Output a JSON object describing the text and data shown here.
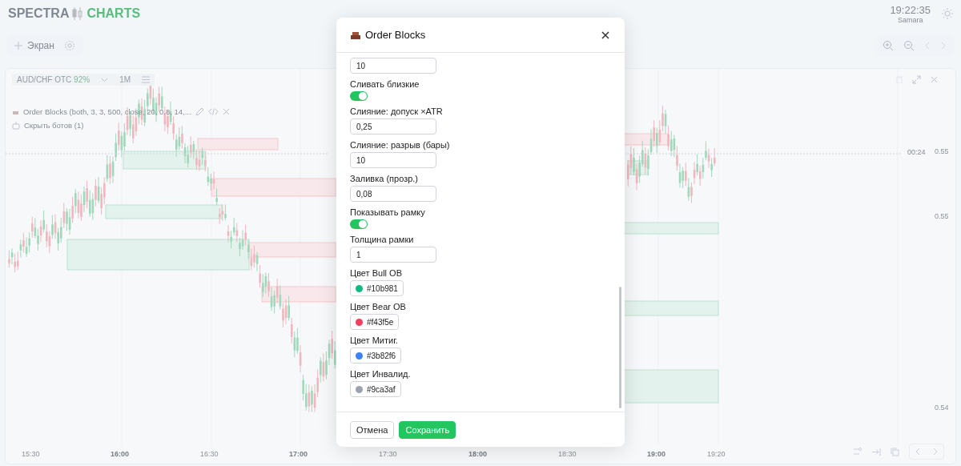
{
  "header": {
    "brand": [
      "SPECTRA",
      "CHARTS"
    ],
    "clock": "19:22:35",
    "city": "Samara"
  },
  "toolbar": {
    "screen_button": "Экран"
  },
  "chart_panel": {
    "symbol": "AUD/CHF OTC",
    "payout": "92%",
    "timeframe": "1M",
    "indicator_legend": "Order Blocks (both, 3, 3, 500, close, 20, 0.8, 14,...",
    "hide_bots": "Скрыть ботов (1)",
    "countdown": "00:24",
    "price_labels": [
      "0.55",
      "0.55",
      "0.54"
    ],
    "time_labels": [
      {
        "label": "15:30",
        "bold": false
      },
      {
        "label": "16:00",
        "bold": true
      },
      {
        "label": "16:30",
        "bold": false
      },
      {
        "label": "17:00",
        "bold": true
      },
      {
        "label": "17:30",
        "bold": false
      },
      {
        "label": "18:00",
        "bold": true
      },
      {
        "label": "18:30",
        "bold": false
      },
      {
        "label": "19:00",
        "bold": true
      },
      {
        "label": "19:20",
        "bold": false
      }
    ]
  },
  "dialog": {
    "title": "Order Blocks",
    "fields": [
      {
        "kind": "number",
        "value": "10"
      },
      {
        "kind": "toggle",
        "label": "Сливать близкие",
        "on": true
      },
      {
        "kind": "number",
        "label": "Слияние: допуск ×ATR",
        "value": "0,25"
      },
      {
        "kind": "number",
        "label": "Слияние: разрыв (бары)",
        "value": "10"
      },
      {
        "kind": "number",
        "label": "Заливка (прозр.)",
        "value": "0,08"
      },
      {
        "kind": "toggle",
        "label": "Показывать рамку",
        "on": true
      },
      {
        "kind": "number",
        "label": "Толщина рамки",
        "value": "1"
      },
      {
        "kind": "color",
        "label": "Цвет Bull OB",
        "value": "#10b981",
        "color": "#10b981"
      },
      {
        "kind": "color",
        "label": "Цвет Bear OB",
        "value": "#f43f5e",
        "color": "#f43f5e"
      },
      {
        "kind": "color",
        "label": "Цвет Митиг.",
        "value": "#3b82f6",
        "color": "#3b82f6"
      },
      {
        "kind": "color",
        "label": "Цвет Инвалид.",
        "value": "#9ca3af",
        "color": "#9ca3af"
      }
    ],
    "buttons": {
      "cancel": "Отмена",
      "save": "Сохранить"
    }
  }
}
